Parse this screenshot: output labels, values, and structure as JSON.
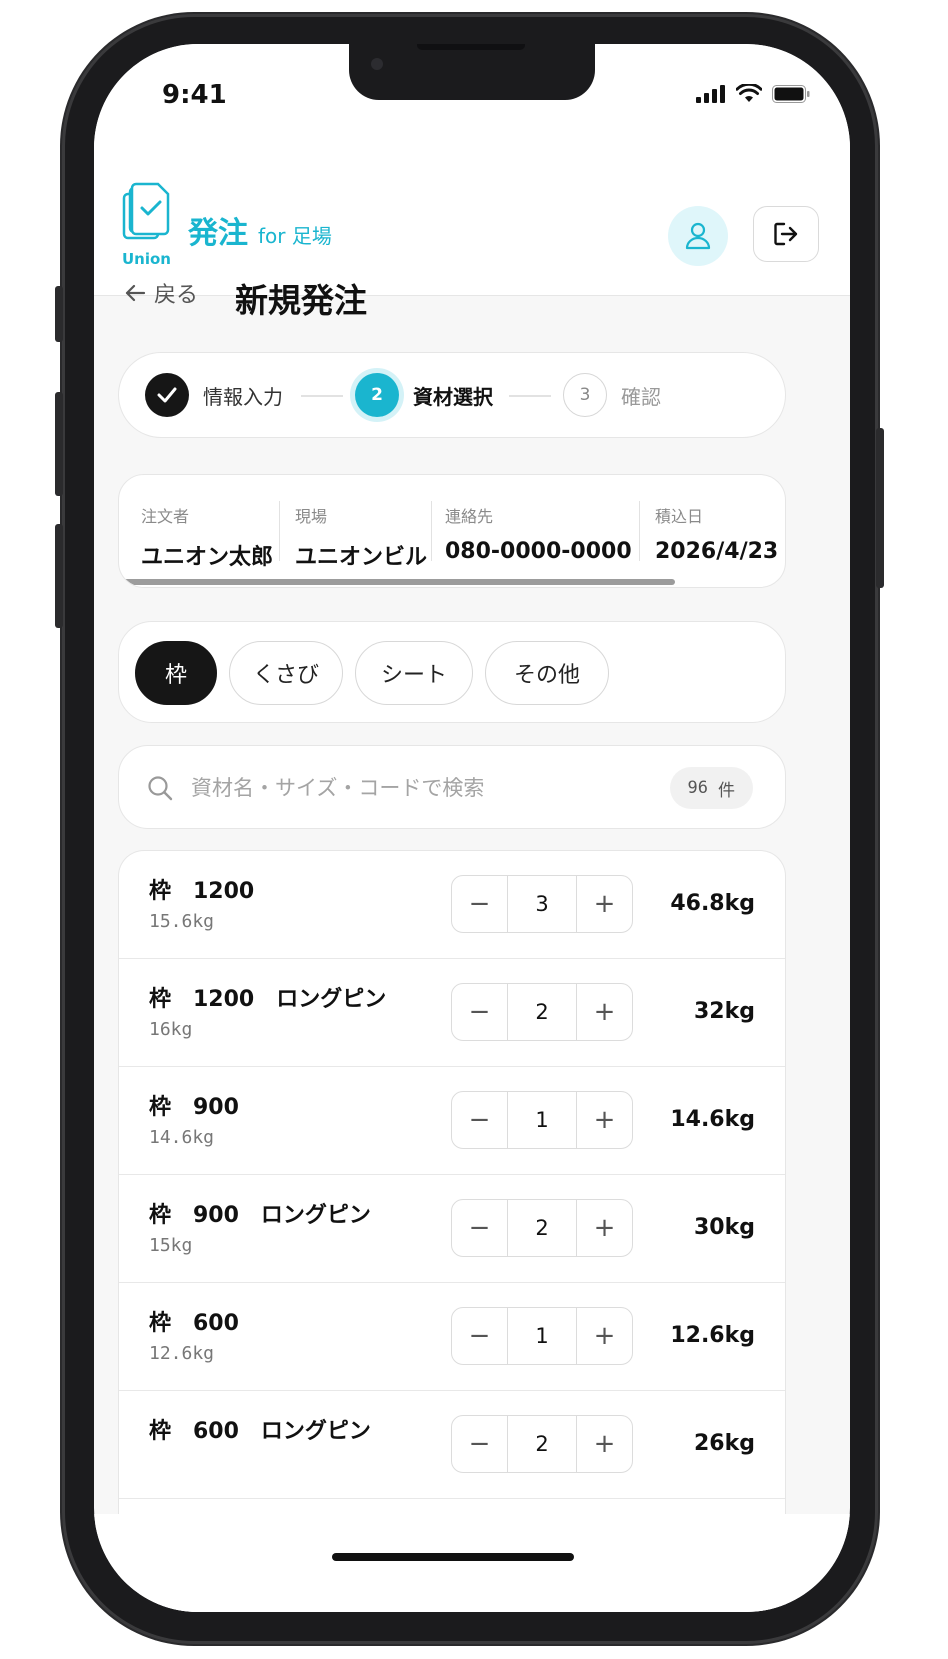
{
  "status_bar": {
    "time": "9:41"
  },
  "header": {
    "logo_text": "Union",
    "brand_main": "発注",
    "brand_sub": "for 足場"
  },
  "nav": {
    "back_label": "戻る",
    "title": "新規発注"
  },
  "stepper": {
    "steps": [
      {
        "label": "情報入力",
        "state": "done"
      },
      {
        "label": "資材選択",
        "number": "2",
        "state": "current"
      },
      {
        "label": "確認",
        "number": "3",
        "state": "upcoming"
      }
    ]
  },
  "order_info": {
    "fields": [
      {
        "label": "注文者",
        "value": "ユニオン太郎"
      },
      {
        "label": "現場",
        "value": "ユニオンビル"
      },
      {
        "label": "連絡先",
        "value": "080-0000-0000"
      },
      {
        "label": "積込日",
        "value": "2026/4/23"
      }
    ]
  },
  "categories": [
    {
      "label": "枠",
      "active": true
    },
    {
      "label": "くさび",
      "active": false
    },
    {
      "label": "シート",
      "active": false
    },
    {
      "label": "その他",
      "active": false
    }
  ],
  "search": {
    "placeholder": "資材名・サイズ・コードで検索",
    "value": "",
    "count": "96",
    "count_unit": "件"
  },
  "items": [
    {
      "name": "枠　1200",
      "unit_weight": "15.6kg",
      "qty": "3",
      "total": "46.8kg"
    },
    {
      "name": "枠　1200　ロングピン",
      "unit_weight": "16kg",
      "qty": "2",
      "total": "32kg"
    },
    {
      "name": "枠　900",
      "unit_weight": "14.6kg",
      "qty": "1",
      "total": "14.6kg"
    },
    {
      "name": "枠　900　ロングピン",
      "unit_weight": "15kg",
      "qty": "2",
      "total": "30kg"
    },
    {
      "name": "枠　600",
      "unit_weight": "12.6kg",
      "qty": "1",
      "total": "12.6kg"
    },
    {
      "name": "枠　600　ロングピン",
      "unit_weight": "",
      "qty": "2",
      "total": "26kg"
    }
  ],
  "colors": {
    "accent": "#1ab5cf",
    "dark": "#161616",
    "background": "#f7f7f7"
  }
}
